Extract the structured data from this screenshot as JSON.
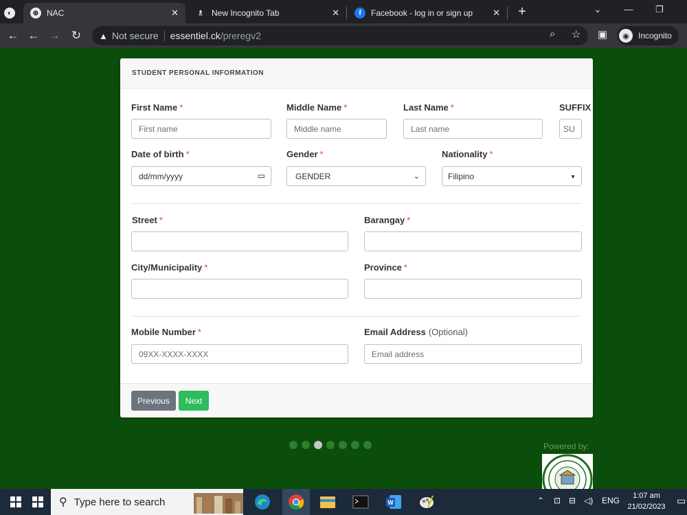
{
  "browser": {
    "tabs": [
      {
        "title": "NAC",
        "favicon": "globe-icon"
      },
      {
        "title": "New Incognito Tab",
        "favicon": "incognito-icon"
      },
      {
        "title": "Facebook - log in or sign up",
        "favicon": "facebook-icon"
      }
    ],
    "address": {
      "security": "Not secure",
      "host": "essentiel.ck",
      "path": "/preregv2"
    },
    "profile_label": "Incognito"
  },
  "form": {
    "header": "STUDENT PERSONAL INFORMATION",
    "required_mark": "*",
    "fields": {
      "first_name": {
        "label": "First Name",
        "placeholder": "First name"
      },
      "middle_name": {
        "label": "Middle Name",
        "placeholder": "Middle name"
      },
      "last_name": {
        "label": "Last Name",
        "placeholder": "Last name"
      },
      "suffix": {
        "label": "SUFFIX",
        "placeholder": "SU"
      },
      "dob": {
        "label": "Date of birth",
        "value": "dd/mm/yyyy"
      },
      "gender": {
        "label": "Gender",
        "value": "GENDER"
      },
      "nationality": {
        "label": "Nationality",
        "value": "Filipino"
      },
      "street": {
        "label": "Street",
        "value": ""
      },
      "barangay": {
        "label": "Barangay",
        "value": ""
      },
      "city": {
        "label": "City/Municipality",
        "value": ""
      },
      "province": {
        "label": "Province",
        "value": ""
      },
      "mobile": {
        "label": "Mobile Number",
        "placeholder": "09XX-XXXX-XXXX"
      },
      "email": {
        "label": "Email Address",
        "optional": "(Optional)",
        "placeholder": "Email address"
      }
    },
    "buttons": {
      "previous": "Previous",
      "next": "Next"
    }
  },
  "pager": {
    "count": 7,
    "active_index": 2
  },
  "footer": {
    "powered_by": "Powered by:"
  },
  "taskbar": {
    "search_placeholder": "Type here to search",
    "language": "ENG",
    "time": "1:07 am",
    "date": "21/02/2023"
  },
  "colors": {
    "page_bg": "#0b4d0b",
    "required": "#e0403d",
    "next_button": "#2ebc5c",
    "previous_button": "#6c757d",
    "pager_active": "#c8c8c8",
    "pager_inactive": "#2f7d2f"
  }
}
